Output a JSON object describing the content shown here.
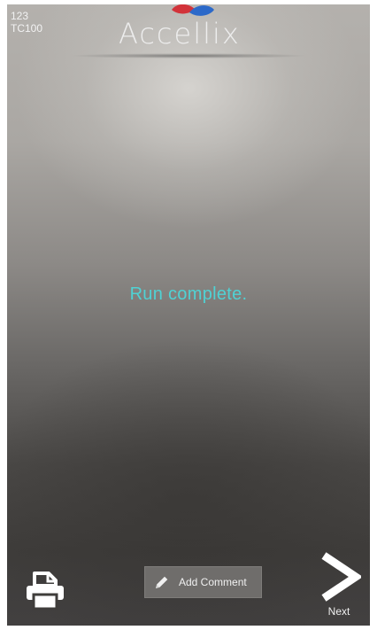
{
  "device": {
    "line1": "123",
    "line2": "TC100"
  },
  "header": {
    "logo_text": "Accellix",
    "logo_colors": {
      "red": "#d2333a",
      "blue": "#2c69c9",
      "text": "#ededed"
    }
  },
  "main": {
    "status_message": "Run complete.",
    "status_color": "#4fd2d4"
  },
  "footer": {
    "print_icon": "printer-icon",
    "add_comment_label": "Add Comment",
    "add_comment_icon": "pencil-icon",
    "next_label": "Next",
    "next_icon": "chevron-right-icon"
  }
}
